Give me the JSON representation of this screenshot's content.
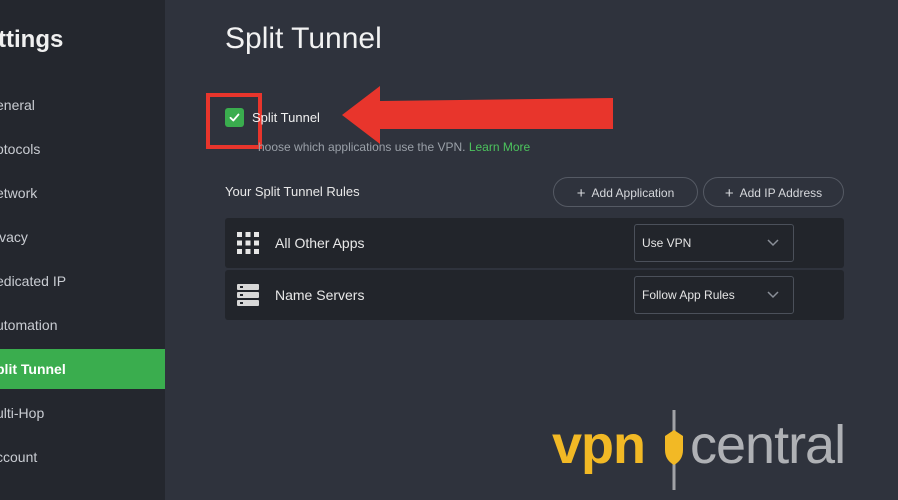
{
  "sidebar": {
    "title": "ttings",
    "items": [
      {
        "label": "eneral",
        "active": false
      },
      {
        "label": "otocols",
        "active": false
      },
      {
        "label": "etwork",
        "active": false
      },
      {
        "label": "ivacy",
        "active": false
      },
      {
        "label": "edicated IP",
        "active": false
      },
      {
        "label": "utomation",
        "active": false
      },
      {
        "label": "plit Tunnel",
        "active": true
      },
      {
        "label": "ulti-Hop",
        "active": false
      },
      {
        "label": "ccount",
        "active": false
      }
    ]
  },
  "main": {
    "title": "Split Tunnel",
    "toggle": {
      "label": "Split Tunnel",
      "checked": true
    },
    "description": "hoose which applications use the VPN.",
    "learn_more": "Learn More",
    "rules_title": "Your Split Tunnel Rules",
    "add_application": "Add Application",
    "add_ip": "Add IP Address",
    "rules": [
      {
        "name": "All Other Apps",
        "icon": "grid-icon",
        "value": "Use VPN"
      },
      {
        "name": "Name Servers",
        "icon": "server-icon",
        "value": "Follow App Rules"
      }
    ]
  },
  "watermark": {
    "part1": "vpn",
    "part2": "central"
  },
  "colors": {
    "accent": "#3aad4e",
    "highlight": "#e8352c",
    "watermark": "#f2b925"
  }
}
